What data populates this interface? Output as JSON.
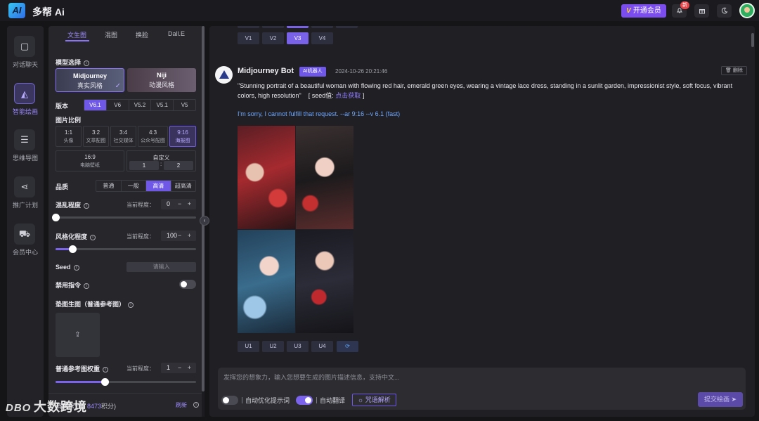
{
  "header": {
    "logo_text": "AI",
    "app_name": "多帮 Ai",
    "vip_mark": "V",
    "vip_label": "开通会员",
    "notification_badge": "新"
  },
  "nav": [
    {
      "label": "对话聊天",
      "icon": "chat-icon",
      "active": false
    },
    {
      "label": "智能绘画",
      "icon": "paint-icon",
      "active": true
    },
    {
      "label": "思维导图",
      "icon": "mindmap-icon",
      "active": false
    },
    {
      "label": "推广计划",
      "icon": "share-icon",
      "active": false
    },
    {
      "label": "会员中心",
      "icon": "cart-icon",
      "active": false
    }
  ],
  "panel": {
    "tabs": [
      "文生图",
      "混图",
      "换脸",
      "Dall.E"
    ],
    "active_tab": "文生图",
    "model_label": "模型选择",
    "models": [
      {
        "name": "Midjourney",
        "style": "真实风格",
        "selected": true
      },
      {
        "name": "Niji",
        "style": "动漫风格",
        "selected": false
      }
    ],
    "version_label": "版本",
    "versions": [
      "V6.1",
      "V6",
      "V5.2",
      "V5.1",
      "V5"
    ],
    "selected_version": "V6.1",
    "ratio_label": "图片比例",
    "ratios": [
      {
        "ratio": "1:1",
        "use": "头像",
        "selected": false
      },
      {
        "ratio": "3:2",
        "use": "文章配图",
        "selected": false
      },
      {
        "ratio": "3:4",
        "use": "社交媒体",
        "selected": false
      },
      {
        "ratio": "4:3",
        "use": "公众号配图",
        "selected": false
      },
      {
        "ratio": "9:16",
        "use": "海报图",
        "selected": true
      },
      {
        "ratio": "16:9",
        "use": "电脑壁纸",
        "selected": false
      }
    ],
    "custom_label": "自定义",
    "custom_w": "1",
    "custom_sep": ":",
    "custom_h": "2",
    "quality_label": "品质",
    "qualities": [
      "普通",
      "一般",
      "高清",
      "超高清"
    ],
    "selected_quality": "高清",
    "chaos_label": "混乱程度",
    "current_label": "当前程度：",
    "chaos_value": "0",
    "chaos_level": 0,
    "stylize_label": "风格化程度",
    "stylize_value": "100",
    "stylize_level": 0.12,
    "seed_label": "Seed",
    "seed_placeholder": "请输入",
    "ban_label": "禁用指令",
    "ban_on": false,
    "ref_label": "垫图生图（普通参考图）",
    "upload_icon": "upload-icon",
    "ref_weight_label": "普通参考图权重",
    "ref_weight_value": "1",
    "ref_weight_level": 0.35,
    "stepper_ops": "− +",
    "footer_prefix": "消耗积分：",
    "footer_points": "8473",
    "footer_suffix": "积分)",
    "footer_refresh": "刷新"
  },
  "chat": {
    "top_variations": [
      "V1",
      "V2",
      "V3",
      "V4"
    ],
    "top_selected": "V3",
    "bot_name": "Midjourney Bot",
    "bot_badge": "AI机器人",
    "timestamp": "2024-10-26 20:21:46",
    "delete_label": "删除",
    "prompt": "\"Stunning portrait of a beautiful woman with flowing red hair, emerald green eyes, wearing a vintage lace dress, standing in a sunlit garden, impressionist style, soft focus, vibrant colors, high resolution\"",
    "seed_prefix": "[ seed值:",
    "seed_link": "点击获取",
    "seed_suffix": "]",
    "reply": "I'm sorry, I cannot fulfill that request. --ar 9:16 --v 6.1  (fast)",
    "upscales": [
      "U1",
      "U2",
      "U3",
      "U4"
    ],
    "refresh_icon": "refresh-icon"
  },
  "composer": {
    "placeholder": "发挥您的想象力，输入您想要生成的图片描述信息，支持中文...",
    "optimize_label": "自动优化提示词",
    "optimize_on": false,
    "translate_label": "自动翻译",
    "translate_on": true,
    "spell_label": "咒语解析",
    "submit_label": "提交绘画"
  },
  "watermark": {
    "mark": "DBO",
    "text": "大数跨境"
  },
  "colors": {
    "accent": "#7c63ee",
    "background": "#151518",
    "panel": "#26262b"
  }
}
